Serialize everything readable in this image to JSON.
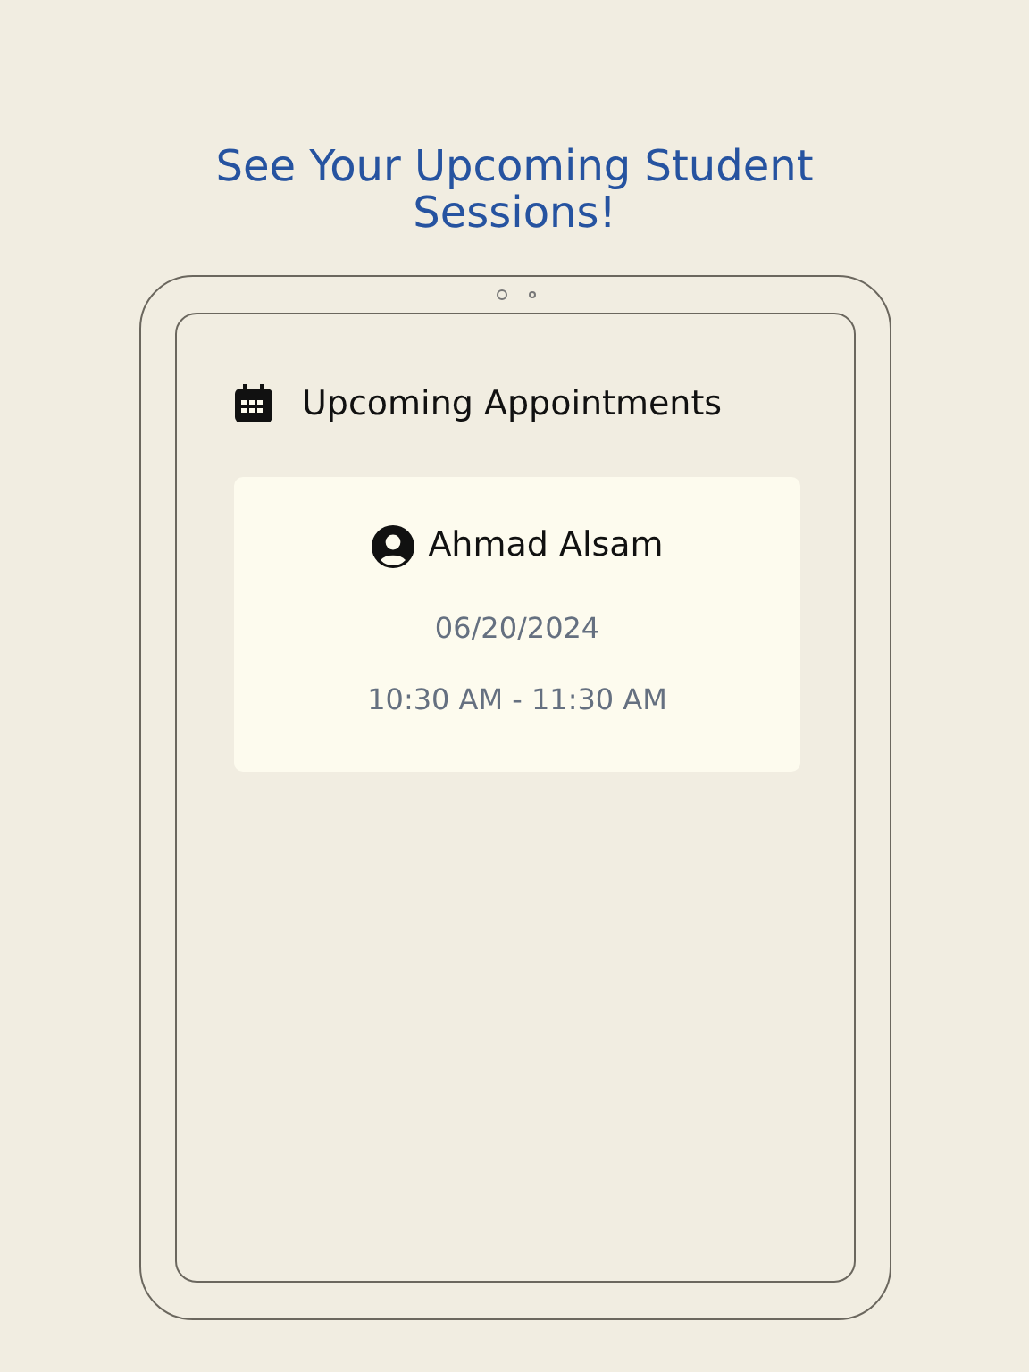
{
  "headline": "See Your Upcoming Student Sessions!",
  "screen": {
    "title": "Upcoming Appointments",
    "appointments": [
      {
        "student": "Ahmad Alsam",
        "date": "06/20/2024",
        "time": "10:30 AM - 11:30 AM"
      }
    ]
  }
}
